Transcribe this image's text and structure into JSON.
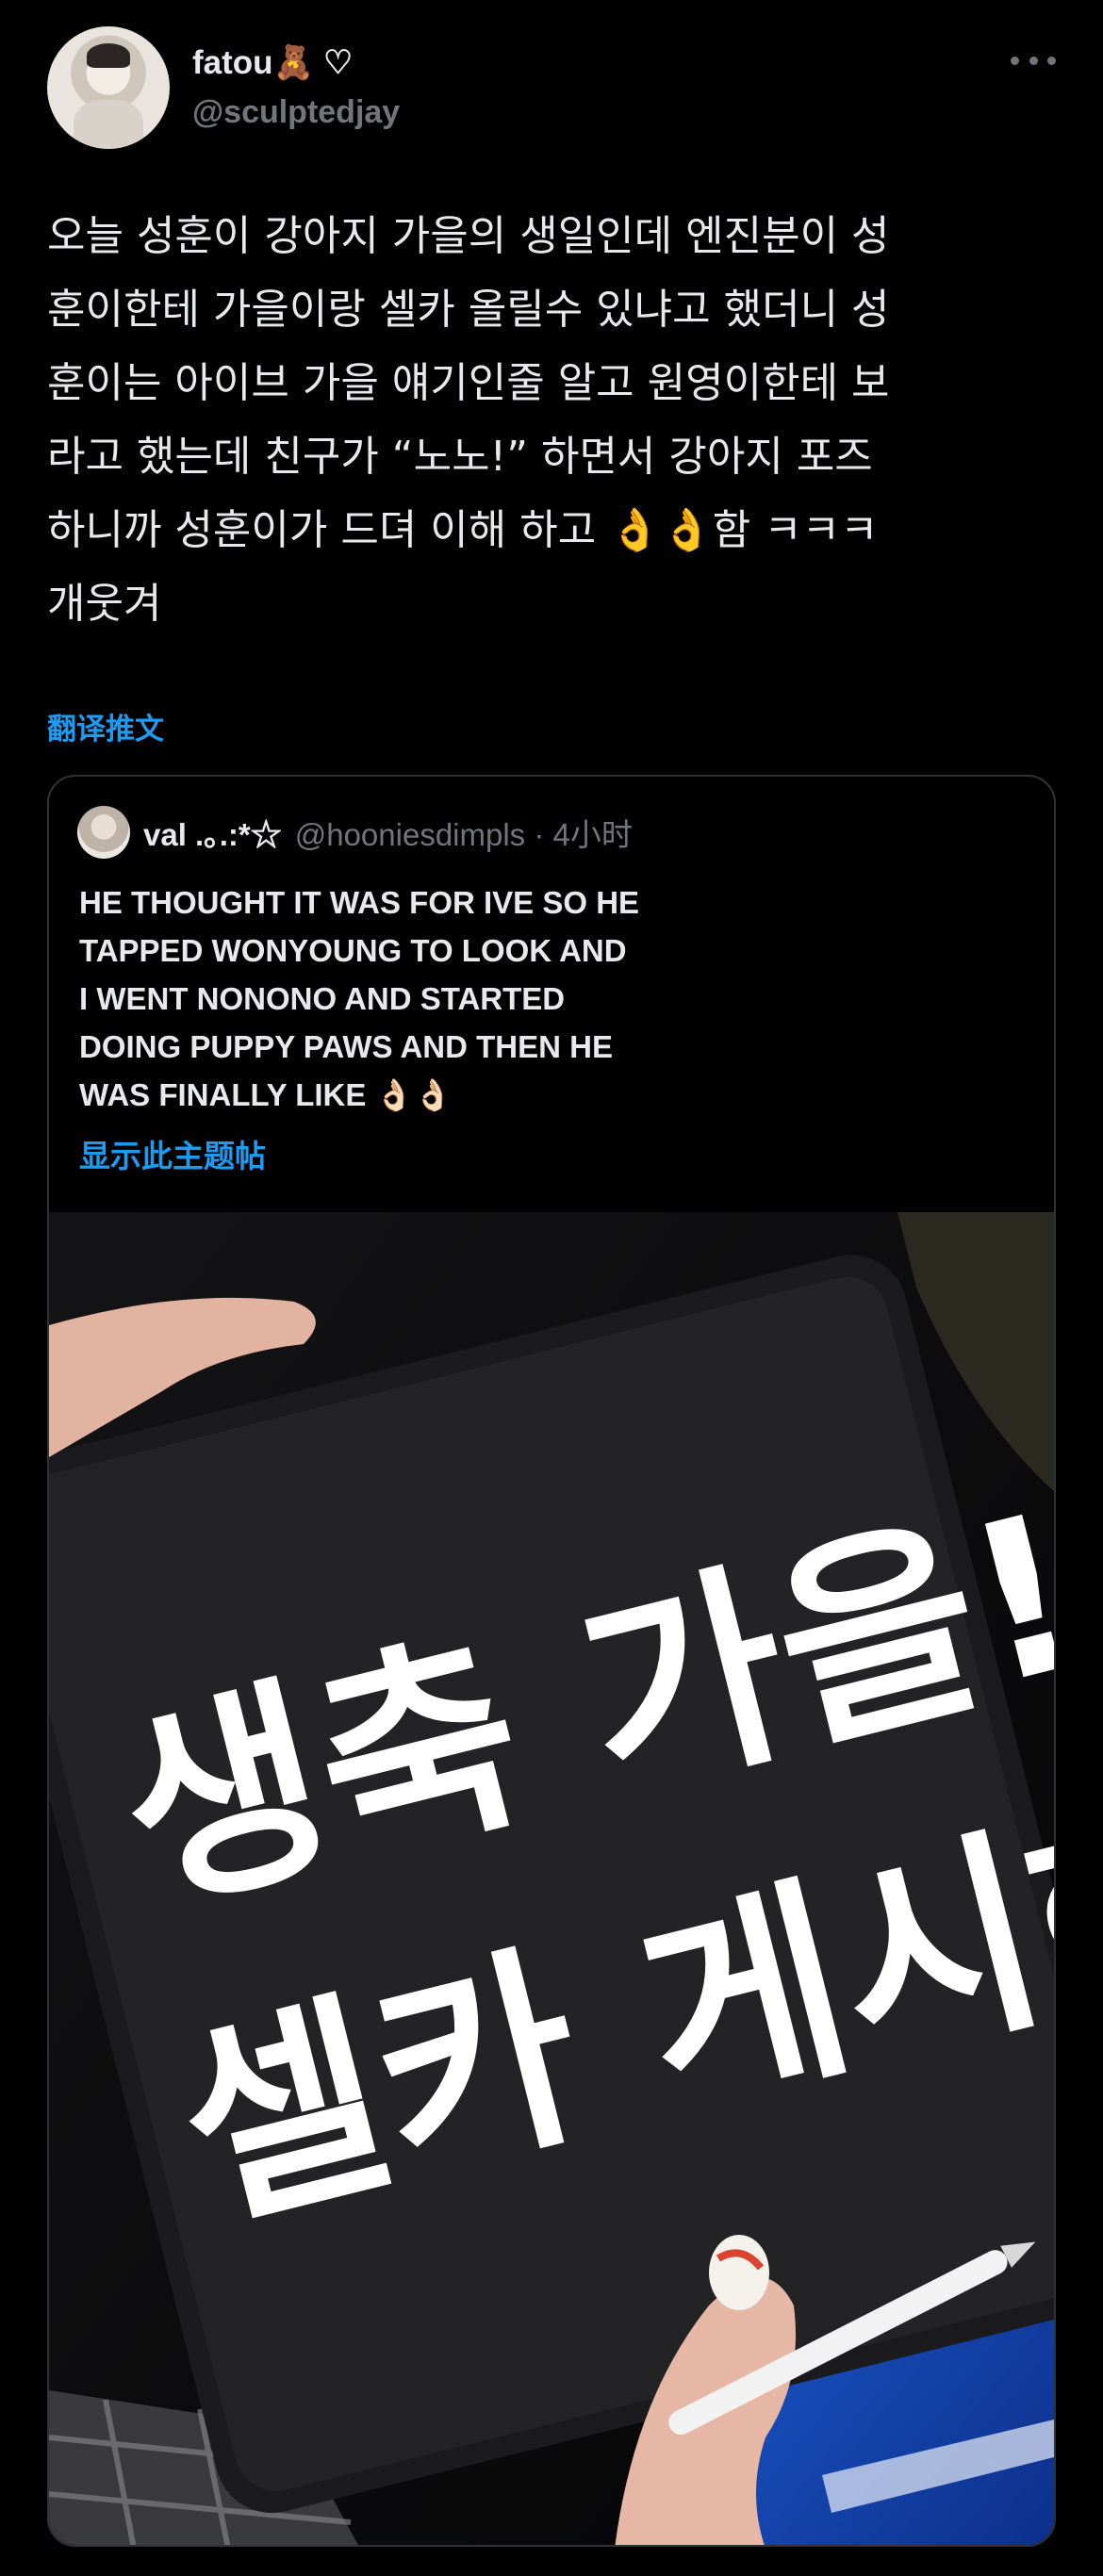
{
  "author": {
    "display_name": "fatou🧸 ♡",
    "handle": "@sculptedjay"
  },
  "tweet": {
    "text": "오늘 성훈이 강아지 가을의 생일인데 엔진분이 성\n훈이한테 가을이랑 셀카 올릴수 있냐고 했더니 성\n훈이는 아이브 가을 얘기인줄 알고 원영이한테 보\n라고 했는데 친구가 “노노!” 하면서 강아지 포즈\n하니까 성훈이가 드뎌 이해 하고 👌👌함 ㅋㅋㅋ\n개웃겨",
    "translate_label": "翻译推文"
  },
  "quoted": {
    "display_name": "val .｡.:*☆",
    "handle_time": "@hooniesdimpls · 4小时",
    "text": "HE THOUGHT IT WAS FOR IVE SO HE\nTAPPED WONYOUNG TO LOOK AND\nI WENT NONONO AND STARTED\nDOING PUPPY PAWS AND THEN HE\nWAS FINALLY LIKE 👌🏻👌🏻",
    "show_thread_label": "显示此主题帖",
    "photo_text_line1": "생축 가을!",
    "photo_text_line2": "셀카 게시해?"
  },
  "icons": {
    "more": "more-horizontal-icon"
  },
  "colors": {
    "background": "#000000",
    "text": "#e7e9ea",
    "secondary_text": "#71767b",
    "link": "#1d9bf0",
    "border": "#2f3336"
  }
}
